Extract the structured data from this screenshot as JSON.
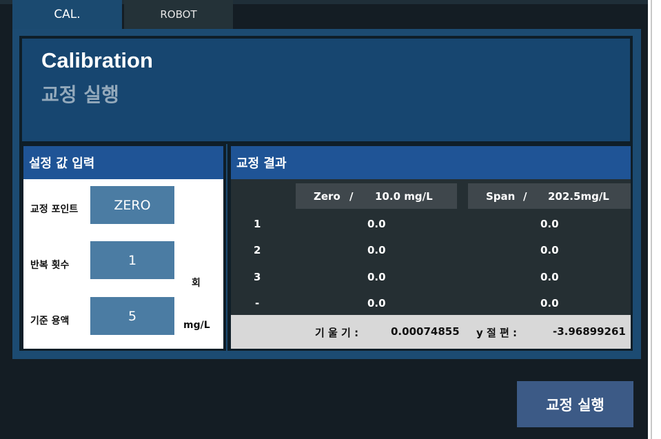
{
  "tabs": [
    {
      "label": "CAL."
    },
    {
      "label": "ROBOT"
    }
  ],
  "header": {
    "title_en": "Calibration",
    "title_ko": "교정 실행"
  },
  "input_section": {
    "title": "설정 값 입력",
    "fields": [
      {
        "label": "교정 포인트",
        "value": "ZERO",
        "unit": ""
      },
      {
        "label": "반복 횟수",
        "value": "1",
        "unit": "회"
      },
      {
        "label": "기준 용액",
        "value": "5",
        "unit": "mg/L"
      }
    ]
  },
  "result_section": {
    "title": "교정 결과",
    "columns": [
      {
        "name": "Zero",
        "sep": "/",
        "value": "10.0 mg/L"
      },
      {
        "name": "Span",
        "sep": "/",
        "value": "202.5mg/L"
      }
    ],
    "rows": [
      {
        "label": "1",
        "zero": "0.0",
        "span": "0.0"
      },
      {
        "label": "2",
        "zero": "0.0",
        "span": "0.0"
      },
      {
        "label": "3",
        "zero": "0.0",
        "span": "0.0"
      },
      {
        "label": "-",
        "zero": "0.0",
        "span": "0.0"
      }
    ],
    "slope_label": "기 울 기 :",
    "slope_value": "0.00074855",
    "intercept_label": "y 절 편 :",
    "intercept_value": "-3.96899261"
  },
  "execute_button": "교정 실행",
  "colors": {
    "background": "#141d24",
    "panel": "#1c4b72",
    "section_head": "#1f5496",
    "field_button": "#4b7ca3",
    "execute_button": "#3c5a86"
  }
}
